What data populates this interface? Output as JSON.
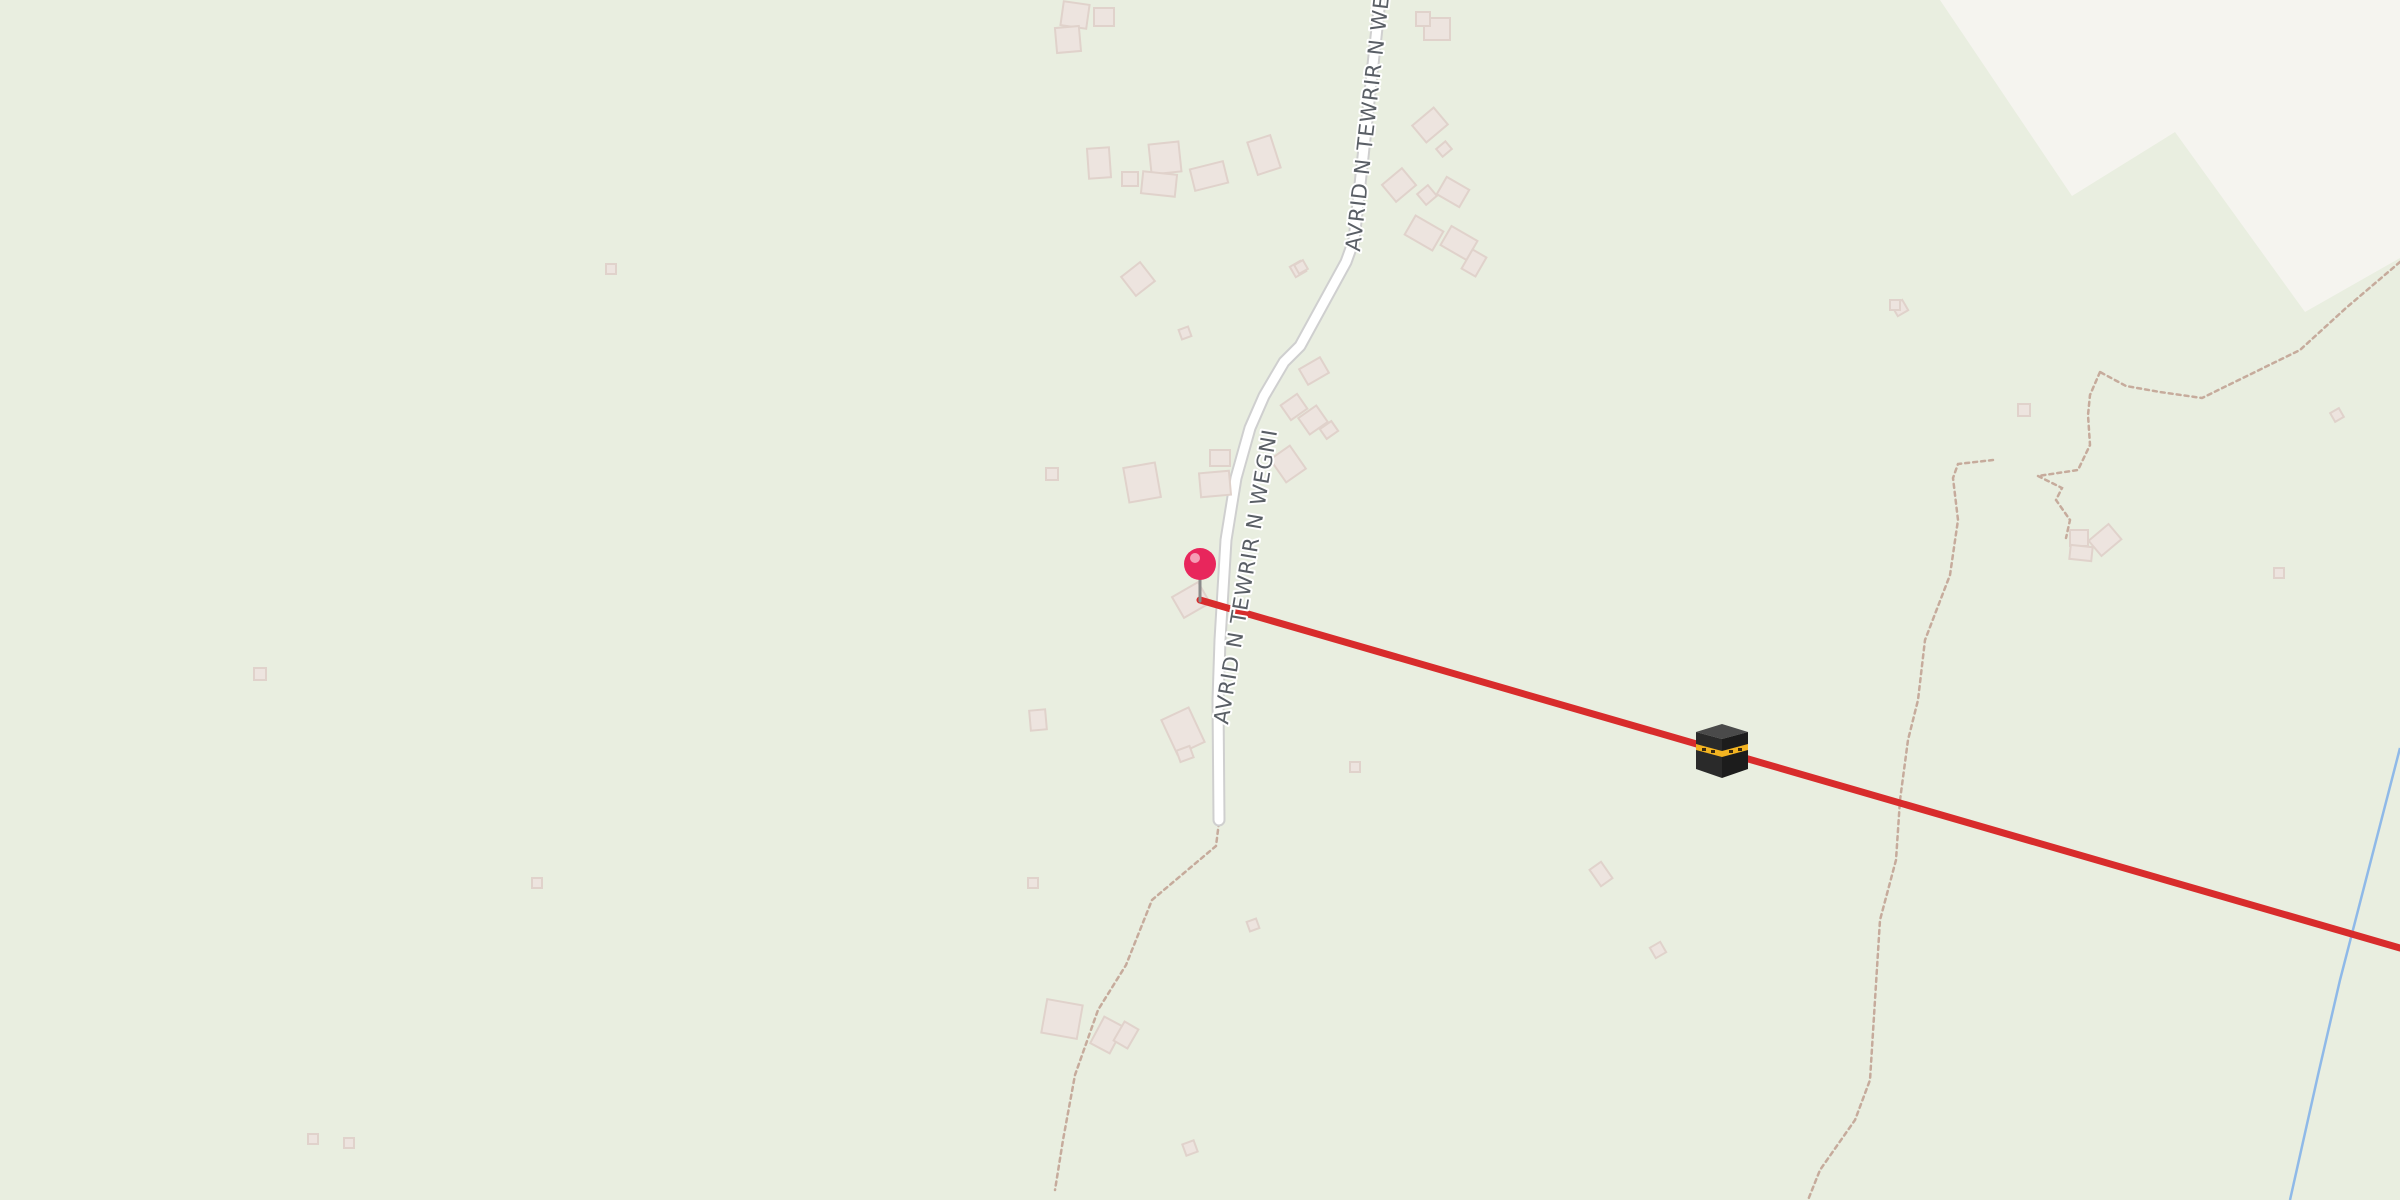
{
  "map": {
    "road_name": "AVRID N TEWRIR N WEGNI",
    "road_name_upper_partial": "AVRID N TEWRIR N WE",
    "marker": {
      "icon": "pin-marker-icon",
      "color": "#e8265c"
    },
    "destination_icon": "kaaba-icon",
    "qibla_line_color": "#d82c2c",
    "colors": {
      "land": "#e9eee0",
      "urban": "#f4f3ee",
      "road": "#ffffff",
      "road_casing": "#c9c9c9",
      "path": "#c5a898",
      "river": "#8fb9e8",
      "building": "#ede4df"
    }
  }
}
